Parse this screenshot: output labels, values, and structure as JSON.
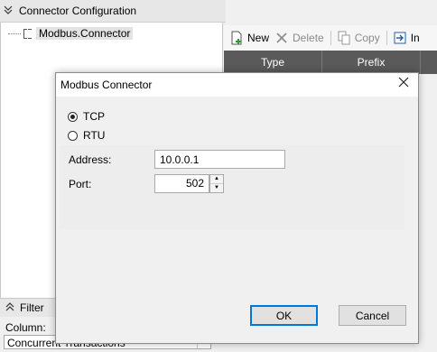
{
  "connector_panel": {
    "title": "Connector Configuration",
    "tree_item": "Modbus.Connector"
  },
  "toolbar": {
    "new_label": "New",
    "delete_label": "Delete",
    "copy_label": "Copy",
    "import_label": "In"
  },
  "grid": {
    "columns": [
      "Type",
      "Prefix"
    ]
  },
  "filter_panel": {
    "title": "Filter",
    "column_label": "Column:",
    "column_value": "Concurrent Transactions"
  },
  "dialog": {
    "title": "Modbus Connector",
    "radio_tcp": "TCP",
    "radio_rtu": "RTU",
    "selected": "TCP",
    "address_label": "Address:",
    "address_value": "10.0.0.1",
    "port_label": "Port:",
    "port_value": "502",
    "ok_label": "OK",
    "cancel_label": "Cancel"
  },
  "icons": [
    "chevron-down-icon",
    "tree-node-icon",
    "new-document-icon",
    "delete-icon",
    "copy-icon",
    "import-icon",
    "close-icon",
    "spinner-up-icon",
    "spinner-down-icon"
  ]
}
